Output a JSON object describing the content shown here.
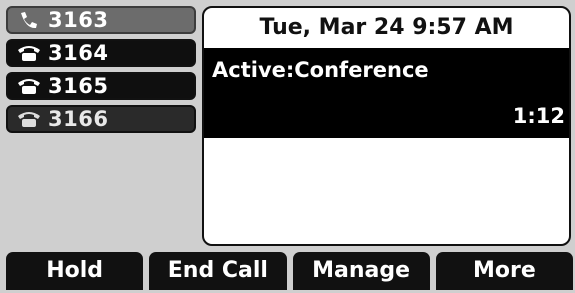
{
  "lines": [
    {
      "label": "3163",
      "icon": "phone-handset-icon",
      "style": "light"
    },
    {
      "label": "3164",
      "icon": "phone-desk-icon",
      "style": "dark"
    },
    {
      "label": "3165",
      "icon": "phone-desk-icon",
      "style": "dark"
    },
    {
      "label": "3166",
      "icon": "phone-desk-icon",
      "style": "gray-text"
    }
  ],
  "status_bar": {
    "datetime": "Tue, Mar 24  9:57 AM"
  },
  "call": {
    "state": "Active:Conference",
    "timer": "1:12"
  },
  "softkeys": [
    "Hold",
    "End Call",
    "Manage",
    "More"
  ]
}
